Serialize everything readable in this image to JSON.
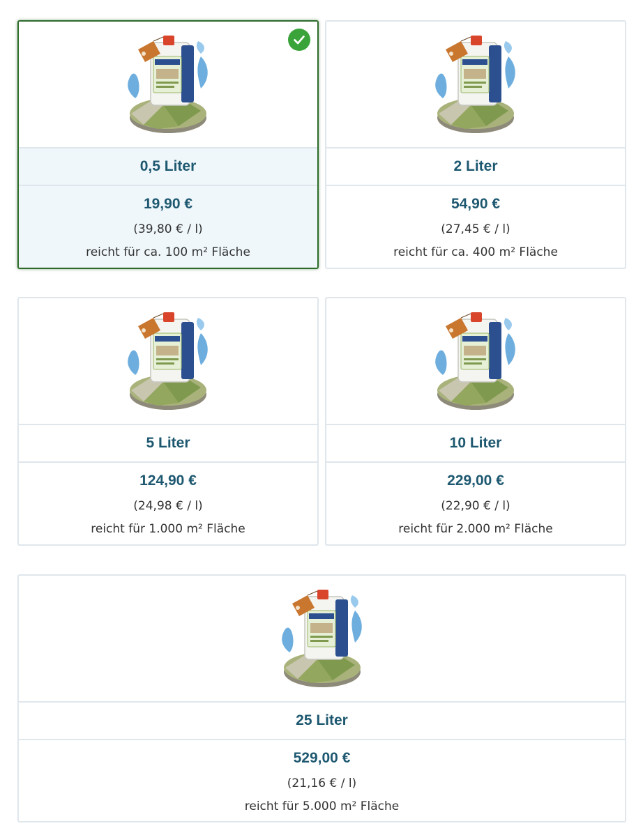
{
  "colors": {
    "accent_text": "#1d5870",
    "selected_border": "#2e6b2a",
    "check_badge": "#3aa33a",
    "selected_background": "#eff7fb",
    "card_border": "#dfe6ec"
  },
  "options": [
    {
      "size": "0,5 Liter",
      "price": "19,90 €",
      "unit_price": "(39,80 € / l)",
      "coverage": "reicht für ca. 100 m² Fläche",
      "selected": true,
      "icon": "check-icon"
    },
    {
      "size": "2 Liter",
      "price": "54,90 €",
      "unit_price": "(27,45 € / l)",
      "coverage": "reicht für ca. 400 m² Fläche",
      "selected": false
    },
    {
      "size": "5 Liter",
      "price": "124,90 €",
      "unit_price": "(24,98 € / l)",
      "coverage": "reicht für 1.000 m² Fläche",
      "selected": false
    },
    {
      "size": "10 Liter",
      "price": "229,00 €",
      "unit_price": "(22,90 € / l)",
      "coverage": "reicht für 2.000 m² Fläche",
      "selected": false
    },
    {
      "size": "25 Liter",
      "price": "529,00 €",
      "unit_price": "(21,16 € / l)",
      "coverage": "reicht für 5.000 m² Fläche",
      "selected": false
    }
  ]
}
